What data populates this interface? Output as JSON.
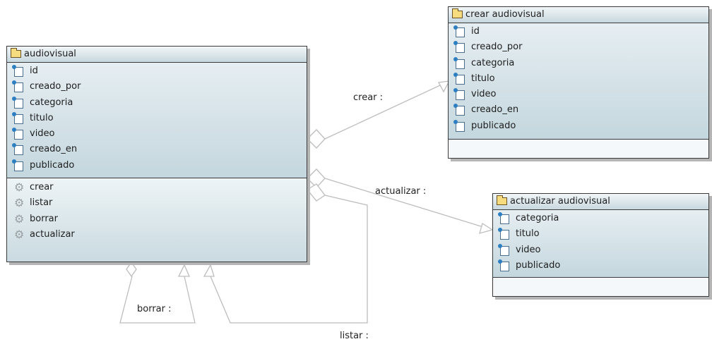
{
  "classes": {
    "audiovisual": {
      "name": "audiovisual",
      "attributes": [
        "id",
        "creado_por",
        "categoria",
        "titulo",
        "video",
        "creado_en",
        "publicado"
      ],
      "operations": [
        "crear",
        "listar",
        "borrar",
        "actualizar"
      ]
    },
    "crear_audiovisual": {
      "name": "crear audiovisual",
      "attributes": [
        "id",
        "creado_por",
        "categoria",
        "titulo",
        "video",
        "creado_en",
        "publicado"
      ]
    },
    "actualizar_audiovisual": {
      "name": "actualizar audiovisual",
      "attributes": [
        "categoria",
        "titulo",
        "video",
        "publicado"
      ]
    }
  },
  "relations": {
    "crear": "crear :",
    "actualizar": "actualizar :",
    "borrar": "borrar :",
    "listar": "listar :"
  },
  "icons": {
    "class": "folder-icon",
    "attribute": "attribute-icon",
    "operation": "gear-icon"
  },
  "colors": {
    "border": "#3a3a3a",
    "header": "#c7d8df",
    "compartment": "#d4e2e7",
    "connector": "#b8b8b8"
  }
}
